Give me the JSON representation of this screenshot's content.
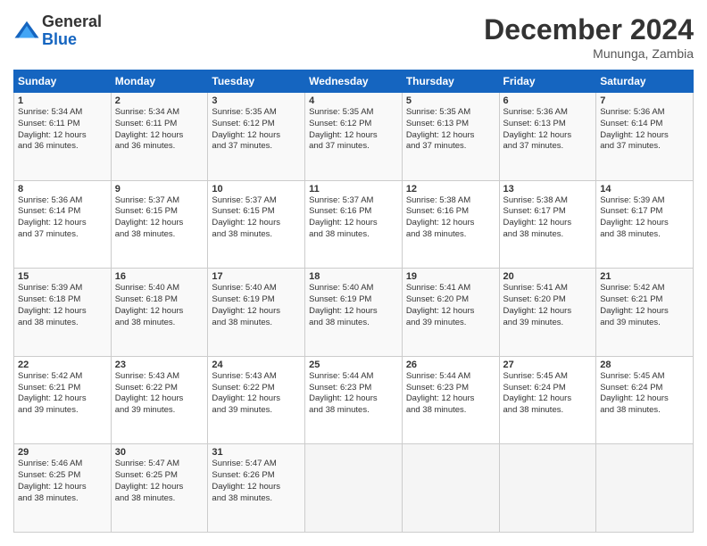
{
  "logo": {
    "general": "General",
    "blue": "Blue"
  },
  "header": {
    "month": "December 2024",
    "location": "Mununga, Zambia"
  },
  "weekdays": [
    "Sunday",
    "Monday",
    "Tuesday",
    "Wednesday",
    "Thursday",
    "Friday",
    "Saturday"
  ],
  "weeks": [
    [
      {
        "day": "1",
        "sunrise": "5:34 AM",
        "sunset": "6:11 PM",
        "daylight": "12 hours and 36 minutes."
      },
      {
        "day": "2",
        "sunrise": "5:34 AM",
        "sunset": "6:11 PM",
        "daylight": "12 hours and 36 minutes."
      },
      {
        "day": "3",
        "sunrise": "5:35 AM",
        "sunset": "6:12 PM",
        "daylight": "12 hours and 37 minutes."
      },
      {
        "day": "4",
        "sunrise": "5:35 AM",
        "sunset": "6:12 PM",
        "daylight": "12 hours and 37 minutes."
      },
      {
        "day": "5",
        "sunrise": "5:35 AM",
        "sunset": "6:13 PM",
        "daylight": "12 hours and 37 minutes."
      },
      {
        "day": "6",
        "sunrise": "5:36 AM",
        "sunset": "6:13 PM",
        "daylight": "12 hours and 37 minutes."
      },
      {
        "day": "7",
        "sunrise": "5:36 AM",
        "sunset": "6:14 PM",
        "daylight": "12 hours and 37 minutes."
      }
    ],
    [
      {
        "day": "8",
        "sunrise": "5:36 AM",
        "sunset": "6:14 PM",
        "daylight": "12 hours and 37 minutes."
      },
      {
        "day": "9",
        "sunrise": "5:37 AM",
        "sunset": "6:15 PM",
        "daylight": "12 hours and 38 minutes."
      },
      {
        "day": "10",
        "sunrise": "5:37 AM",
        "sunset": "6:15 PM",
        "daylight": "12 hours and 38 minutes."
      },
      {
        "day": "11",
        "sunrise": "5:37 AM",
        "sunset": "6:16 PM",
        "daylight": "12 hours and 38 minutes."
      },
      {
        "day": "12",
        "sunrise": "5:38 AM",
        "sunset": "6:16 PM",
        "daylight": "12 hours and 38 minutes."
      },
      {
        "day": "13",
        "sunrise": "5:38 AM",
        "sunset": "6:17 PM",
        "daylight": "12 hours and 38 minutes."
      },
      {
        "day": "14",
        "sunrise": "5:39 AM",
        "sunset": "6:17 PM",
        "daylight": "12 hours and 38 minutes."
      }
    ],
    [
      {
        "day": "15",
        "sunrise": "5:39 AM",
        "sunset": "6:18 PM",
        "daylight": "12 hours and 38 minutes."
      },
      {
        "day": "16",
        "sunrise": "5:40 AM",
        "sunset": "6:18 PM",
        "daylight": "12 hours and 38 minutes."
      },
      {
        "day": "17",
        "sunrise": "5:40 AM",
        "sunset": "6:19 PM",
        "daylight": "12 hours and 38 minutes."
      },
      {
        "day": "18",
        "sunrise": "5:40 AM",
        "sunset": "6:19 PM",
        "daylight": "12 hours and 38 minutes."
      },
      {
        "day": "19",
        "sunrise": "5:41 AM",
        "sunset": "6:20 PM",
        "daylight": "12 hours and 39 minutes."
      },
      {
        "day": "20",
        "sunrise": "5:41 AM",
        "sunset": "6:20 PM",
        "daylight": "12 hours and 39 minutes."
      },
      {
        "day": "21",
        "sunrise": "5:42 AM",
        "sunset": "6:21 PM",
        "daylight": "12 hours and 39 minutes."
      }
    ],
    [
      {
        "day": "22",
        "sunrise": "5:42 AM",
        "sunset": "6:21 PM",
        "daylight": "12 hours and 39 minutes."
      },
      {
        "day": "23",
        "sunrise": "5:43 AM",
        "sunset": "6:22 PM",
        "daylight": "12 hours and 39 minutes."
      },
      {
        "day": "24",
        "sunrise": "5:43 AM",
        "sunset": "6:22 PM",
        "daylight": "12 hours and 39 minutes."
      },
      {
        "day": "25",
        "sunrise": "5:44 AM",
        "sunset": "6:23 PM",
        "daylight": "12 hours and 38 minutes."
      },
      {
        "day": "26",
        "sunrise": "5:44 AM",
        "sunset": "6:23 PM",
        "daylight": "12 hours and 38 minutes."
      },
      {
        "day": "27",
        "sunrise": "5:45 AM",
        "sunset": "6:24 PM",
        "daylight": "12 hours and 38 minutes."
      },
      {
        "day": "28",
        "sunrise": "5:45 AM",
        "sunset": "6:24 PM",
        "daylight": "12 hours and 38 minutes."
      }
    ],
    [
      {
        "day": "29",
        "sunrise": "5:46 AM",
        "sunset": "6:25 PM",
        "daylight": "12 hours and 38 minutes."
      },
      {
        "day": "30",
        "sunrise": "5:47 AM",
        "sunset": "6:25 PM",
        "daylight": "12 hours and 38 minutes."
      },
      {
        "day": "31",
        "sunrise": "5:47 AM",
        "sunset": "6:26 PM",
        "daylight": "12 hours and 38 minutes."
      },
      null,
      null,
      null,
      null
    ]
  ]
}
